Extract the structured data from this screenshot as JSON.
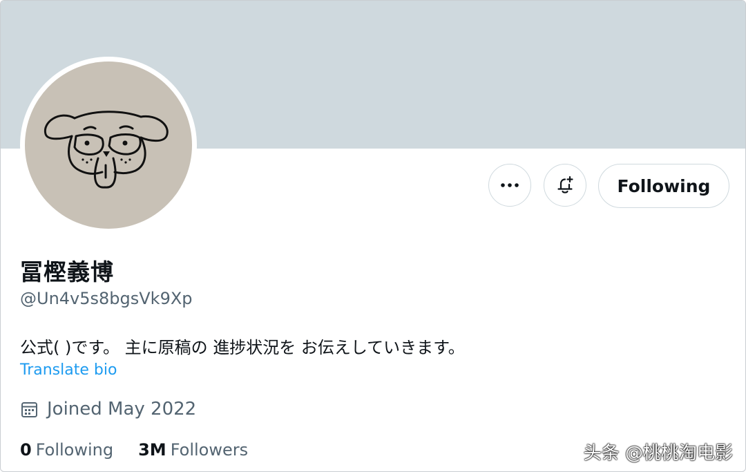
{
  "banner": {
    "color": "#cfd9de"
  },
  "avatar": {
    "bg_color": "#c8c1b6"
  },
  "actions": {
    "more_icon": "ellipsis-icon",
    "notify_icon": "bell-plus-icon",
    "following_label": "Following"
  },
  "profile": {
    "display_name": "冨樫義博",
    "handle": "@Un4v5s8bgsVk9Xp",
    "bio": "公式( )です。 主に原稿の 進捗状況を お伝えしていきます。",
    "translate_label": "Translate bio",
    "joined_icon": "calendar-icon",
    "joined": "Joined May 2022"
  },
  "stats": {
    "following_count": "0",
    "following_label": "Following",
    "followers_count": "3M",
    "followers_label": "Followers"
  },
  "watermark": "头条 @桃桃淘电影",
  "colors": {
    "text_primary": "#0f1419",
    "text_secondary": "#536471",
    "link": "#1d9bf0",
    "border": "#cfd9de"
  }
}
